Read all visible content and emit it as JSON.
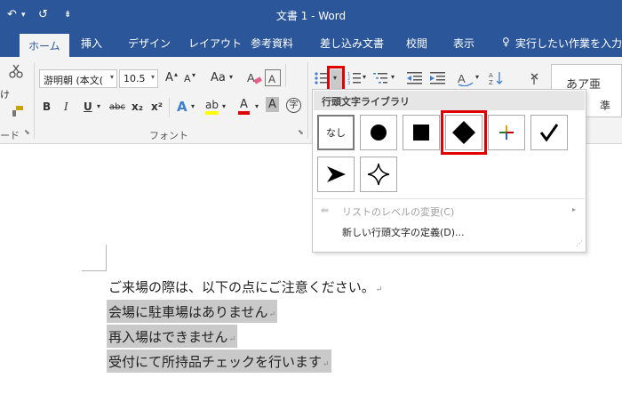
{
  "app": {
    "title": "文書 1  -  Word",
    "qa_undo": "↶",
    "qa_undo_dd": "▾",
    "qa_redo": "↺",
    "qa_more": "⇟"
  },
  "tabs": [
    "ホーム",
    "挿入",
    "デザイン",
    "レイアウト",
    "参考資料",
    "差し込み文書",
    "校閲",
    "表示"
  ],
  "tell_me": "実行したい作業を入力し",
  "ribbon": {
    "font_name": "游明朝 (本文(",
    "font_size": "10.5",
    "grow": "A",
    "shrink": "A",
    "case": "Aa",
    "bold": "B",
    "italic": "I",
    "underline": "U",
    "strike": "abc",
    "subscript": "x₂",
    "superscript": "x²",
    "effects": "A",
    "highlight": "ab",
    "font_color": "A",
    "char_shade": "A",
    "enclose": "字",
    "clipboard_label": "ード",
    "font_group_label": "フォント",
    "style_sample": "あア亜",
    "style_sample2": "準",
    "paste_short": "け"
  },
  "bullet_panel": {
    "header": "行頭文字ライブラリ",
    "none_label": "なし",
    "bullets": [
      "none",
      "filled-circle",
      "filled-square",
      "filled-diamond",
      "arrow-4color",
      "checkmark",
      "arrowhead",
      "four-point-star"
    ],
    "selected": "filled-diamond",
    "menu": [
      {
        "label": "リストのレベルの変更(C)",
        "enabled": false
      },
      {
        "label": "新しい行頭文字の定義(D)...",
        "enabled": true
      }
    ]
  },
  "document": {
    "lines": [
      {
        "text": "ご来場の際は、以下の点にご注意ください。",
        "selected": false
      },
      {
        "text": "会場に駐車場はありません",
        "selected": true
      },
      {
        "text": "再入場はできません",
        "selected": true
      },
      {
        "text": "受付にて所持品チェックを行います",
        "selected": true
      }
    ],
    "para_mark": "↵"
  },
  "colors": {
    "brand": "#2b579a",
    "ribbon": "#f3f3f3",
    "highlight_red": "#e00000",
    "selection": "#c9c9c9"
  }
}
